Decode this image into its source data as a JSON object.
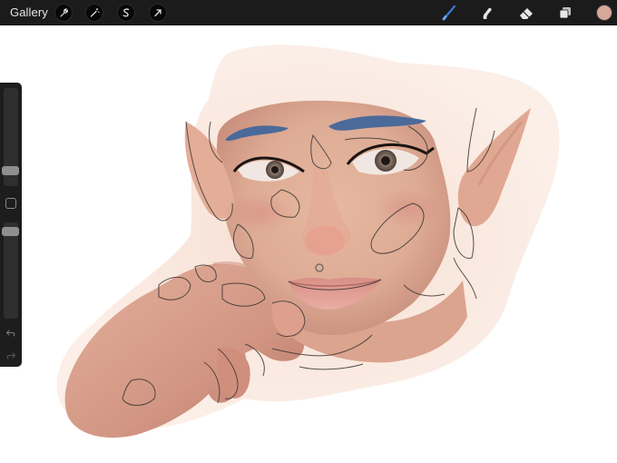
{
  "topbar": {
    "gallery_label": "Gallery",
    "left_tools": [
      "wrench-icon",
      "magic-wand-icon",
      "selection-s-icon",
      "transform-arrow-icon"
    ],
    "right_tools": [
      "brush-icon",
      "smudge-icon",
      "eraser-icon",
      "layers-icon"
    ],
    "active_tool": "brush-icon",
    "active_tool_color": "#3a7bd5",
    "color_swatch": "#d7a79a"
  },
  "sidebar": {
    "brush_size_level": 0.5,
    "opacity_level": 0.95,
    "icons": [
      "modify-square-icon",
      "undo-icon",
      "redo-icon"
    ]
  },
  "canvas": {
    "background": "#ffffff",
    "artwork": "elf-portrait-painting"
  }
}
